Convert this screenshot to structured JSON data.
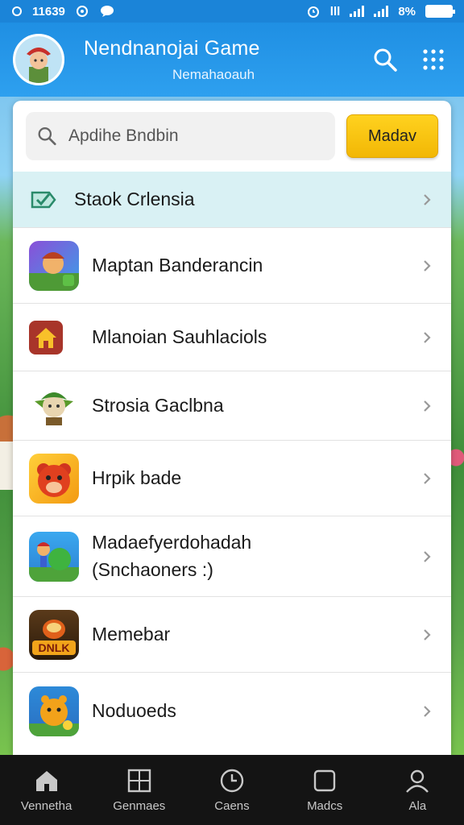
{
  "status_bar": {
    "time": "11639",
    "battery": "8%",
    "left_icons": [
      "sync-icon",
      "chat-icon"
    ],
    "right_icons": [
      "alarm-icon",
      "data-icon",
      "signal-icon",
      "signal-icon",
      "battery-icon"
    ]
  },
  "header": {
    "title": "Nendnanojai Game",
    "subtitle": "Nemahaoauh",
    "avatar_icon": "character-avatar-icon",
    "search_icon": "search-icon",
    "menu_icon": "grid-menu-icon",
    "bg_color": "#1f8fe3"
  },
  "search": {
    "placeholder": "Apdihe Bndbin",
    "button_label": "Madav",
    "button_color": "#f6c30d"
  },
  "list": {
    "highlight": {
      "label": "Staok Crlensia",
      "icon": "checkmark-tag-icon",
      "bg_color": "#d9f1f4"
    },
    "items": [
      {
        "label": "Maptan Banderancin",
        "icon": "warrior-game-icon"
      },
      {
        "label": "Mlanoian Sauhlaciols",
        "icon": "house-icon"
      },
      {
        "label": "Strosia Gaclbna",
        "icon": "goblin-game-icon"
      },
      {
        "label": "Hrpik bade",
        "icon": "bear-game-icon"
      },
      {
        "label": "Madaefyerdohadah",
        "sublabel": "(Snchaoners :)",
        "icon": "adventure-game-icon"
      },
      {
        "label": "Memebar",
        "icon": "drum-game-icon",
        "icon_text": "DNLK"
      },
      {
        "label": "Noduoeds",
        "icon": "fruit-game-icon"
      }
    ]
  },
  "bottom_nav": [
    {
      "label": "Vennetha",
      "icon": "home-icon"
    },
    {
      "label": "Genmaes",
      "icon": "grid-box-icon"
    },
    {
      "label": "Caens",
      "icon": "clock-icon"
    },
    {
      "label": "Madcs",
      "icon": "square-icon"
    },
    {
      "label": "Ala",
      "icon": "person-icon"
    }
  ]
}
